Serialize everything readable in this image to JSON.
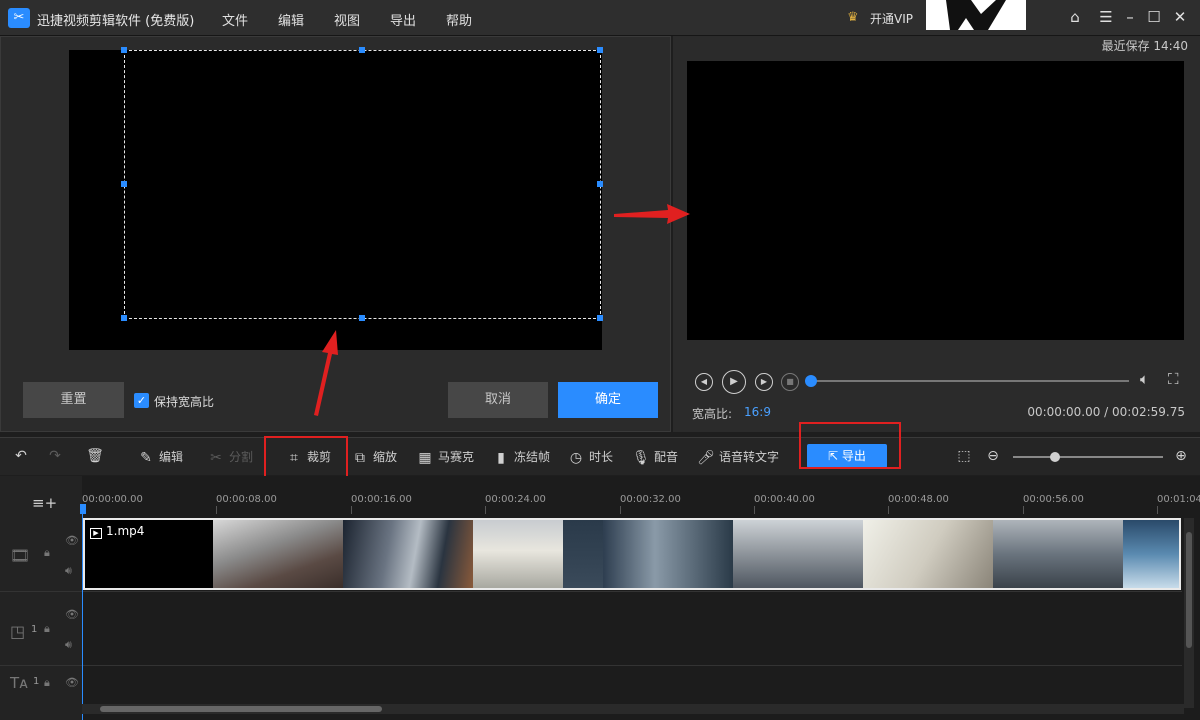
{
  "titlebar": {
    "app_title": "迅捷视频剪辑软件 (免费版)",
    "menus": [
      "文件",
      "编辑",
      "视图",
      "导出",
      "帮助"
    ],
    "vip_label": "开通VIP"
  },
  "crop_panel": {
    "reset_label": "重置",
    "keep_ratio_label": "保持宽高比",
    "keep_ratio_checked": true,
    "cancel_label": "取消",
    "confirm_label": "确定"
  },
  "preview": {
    "last_save": "最近保存 14:40",
    "ratio_label": "宽高比:",
    "ratio_value": "16:9",
    "time_readout": "00:00:00.00 / 00:02:59.75",
    "progress_fraction": 0
  },
  "toolbar": {
    "edit": "编辑",
    "split": "分割",
    "crop": "裁剪",
    "zoom": "缩放",
    "mosaic": "马赛克",
    "freeze": "冻结帧",
    "duration": "时长",
    "dub": "配音",
    "speech_to_text": "语音转文字",
    "export": "导出",
    "zoom_level_fraction": 0.28
  },
  "timeline": {
    "ticks": [
      "00:00:00.00",
      "00:00:08.00",
      "00:00:16.00",
      "00:00:24.00",
      "00:00:32.00",
      "00:00:40.00",
      "00:00:48.00",
      "00:00:56.00",
      "00:01:04"
    ],
    "clip_name": "1.mp4",
    "pip_track_number": "1",
    "text_track_number": "1"
  },
  "colors": {
    "accent": "#2a8cff",
    "highlight": "#e02020"
  }
}
